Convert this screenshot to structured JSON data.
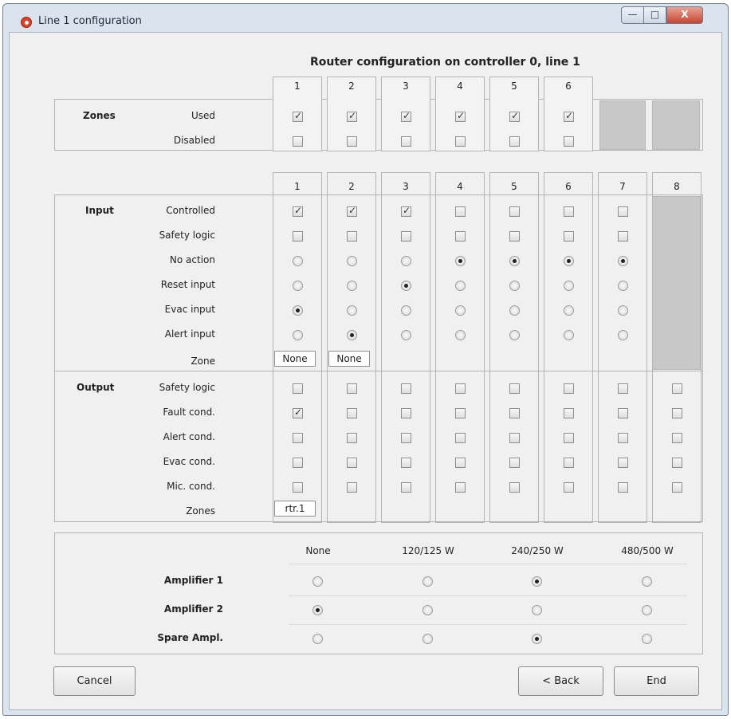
{
  "window": {
    "title": "Line 1 configuration",
    "min_glyph": "—",
    "max_glyph": "□",
    "close_glyph": "X",
    "icon": "app-icon"
  },
  "heading": "Router configuration on controller 0, line 1",
  "zones": {
    "section_label": "Zones",
    "columns": [
      "1",
      "2",
      "3",
      "4",
      "5",
      "6"
    ],
    "rows": [
      {
        "label": "Used",
        "values": [
          true,
          true,
          true,
          true,
          true,
          true
        ]
      },
      {
        "label": "Disabled",
        "values": [
          false,
          false,
          false,
          false,
          false,
          false
        ]
      }
    ]
  },
  "io": {
    "columns": [
      "1",
      "2",
      "3",
      "4",
      "5",
      "6",
      "7",
      "8"
    ],
    "input": {
      "section_label": "Input",
      "checkbox_rows": [
        {
          "label": "Controlled",
          "values": [
            true,
            true,
            true,
            false,
            false,
            false,
            false
          ]
        },
        {
          "label": "Safety logic",
          "values": [
            false,
            false,
            false,
            false,
            false,
            false,
            false
          ]
        }
      ],
      "radio_labels": [
        "No action",
        "Reset input",
        "Evac input",
        "Alert input"
      ],
      "radio_selected_row": [
        2,
        3,
        1,
        0,
        0,
        0,
        0
      ],
      "zone_label": "Zone",
      "zone_values": [
        "None",
        "None"
      ]
    },
    "output": {
      "section_label": "Output",
      "rows": [
        {
          "label": "Safety logic",
          "values": [
            false,
            false,
            false,
            false,
            false,
            false,
            false,
            false
          ]
        },
        {
          "label": "Fault cond.",
          "values": [
            true,
            false,
            false,
            false,
            false,
            false,
            false,
            false
          ]
        },
        {
          "label": "Alert cond.",
          "values": [
            false,
            false,
            false,
            false,
            false,
            false,
            false,
            false
          ]
        },
        {
          "label": "Evac cond.",
          "values": [
            false,
            false,
            false,
            false,
            false,
            false,
            false,
            false
          ]
        },
        {
          "label": "Mic. cond.",
          "values": [
            false,
            false,
            false,
            false,
            false,
            false,
            false,
            false
          ]
        }
      ],
      "zones_label": "Zones",
      "zones_values": [
        "rtr.1"
      ]
    }
  },
  "amplifiers": {
    "columns": [
      "None",
      "120/125 W",
      "240/250 W",
      "480/500 W"
    ],
    "rows": [
      {
        "label": "Amplifier 1",
        "selected": 2
      },
      {
        "label": "Amplifier 2",
        "selected": 0
      },
      {
        "label": "Spare Ampl.",
        "selected": 2
      }
    ]
  },
  "buttons": {
    "cancel": "Cancel",
    "back": "< Back",
    "end": "End"
  }
}
